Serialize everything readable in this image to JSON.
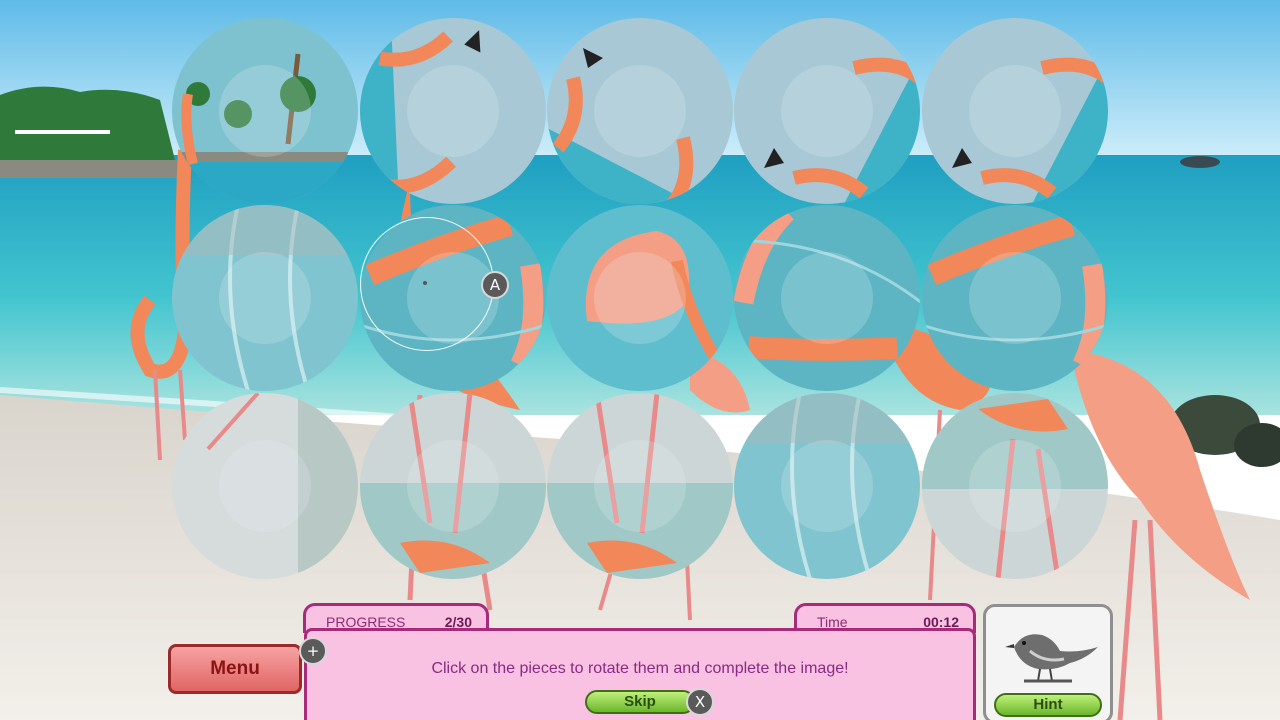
{
  "hud": {
    "progress_label": "PROGRESS",
    "progress_value": "2/30",
    "progress_fraction": 0.0667,
    "time_label": "Time",
    "time_value": "00:12",
    "instruction": "Click on the pieces to rotate them and complete the image!",
    "menu_label": "Menu",
    "skip_label": "Skip",
    "hint_label": "Hint",
    "plus_glyph": "+",
    "x_glyph": "X",
    "a_glyph": "A"
  },
  "puzzle": {
    "rows": 3,
    "cols": 5,
    "pieces": [
      {
        "id": "r1c1",
        "content": "palm-trees",
        "rotation_deg": 180
      },
      {
        "id": "r1c2",
        "content": "flamingo-head",
        "rotation_deg": 150
      },
      {
        "id": "r1c3",
        "content": "flamingo-head",
        "rotation_deg": 90
      },
      {
        "id": "r1c4",
        "content": "flamingo-head",
        "rotation_deg": 0
      },
      {
        "id": "r1c5",
        "content": "flamingo-head",
        "rotation_deg": 0
      },
      {
        "id": "r2c1",
        "content": "water",
        "rotation_deg": 90
      },
      {
        "id": "r2c2",
        "content": "flamingo-neck",
        "rotation_deg": 0
      },
      {
        "id": "r2c3",
        "content": "flamingo-body",
        "rotation_deg": 270
      },
      {
        "id": "r2c4",
        "content": "flamingo-neck",
        "rotation_deg": 200
      },
      {
        "id": "r2c5",
        "content": "flamingo-neck",
        "rotation_deg": 0
      },
      {
        "id": "r3c1",
        "content": "sand",
        "rotation_deg": 180
      },
      {
        "id": "r3c2",
        "content": "flamingo-legs",
        "rotation_deg": 0
      },
      {
        "id": "r3c3",
        "content": "flamingo-legs",
        "rotation_deg": 0
      },
      {
        "id": "r3c4",
        "content": "water",
        "rotation_deg": 90
      },
      {
        "id": "r3c5",
        "content": "flamingo-legs",
        "rotation_deg": 180
      }
    ]
  },
  "icons": {
    "hint": "bird-icon",
    "plus": "plus-icon",
    "close": "close-icon",
    "controller_a": "a-button-icon"
  },
  "colors": {
    "hud_fill": "#f9c1e2",
    "hud_border": "#a72a7b",
    "hud_text": "#8a2a84",
    "menu_fill": "#e06565",
    "green_button": "#6bb62c",
    "flamingo": "#f2875a",
    "water": "#3dbfc9",
    "sky": "#8fd2ef",
    "sand": "#ece7e2"
  }
}
